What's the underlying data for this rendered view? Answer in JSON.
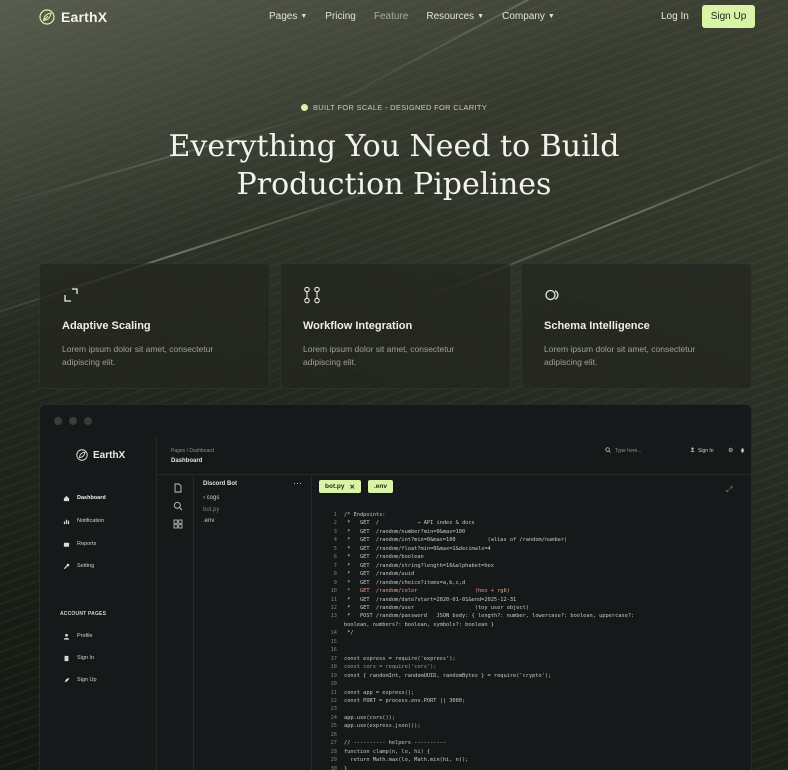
{
  "nav": {
    "logo": "EarthX",
    "menu": [
      {
        "label": "Pages",
        "has_dropdown": true
      },
      {
        "label": "Pricing",
        "has_dropdown": false
      },
      {
        "label": "Feature",
        "has_dropdown": false
      },
      {
        "label": "Resources",
        "has_dropdown": true
      },
      {
        "label": "Company",
        "has_dropdown": true
      }
    ],
    "login": "Log In",
    "signup": "Sign Up"
  },
  "hero": {
    "badge": "BUILT FOR SCALE - DESIGNED FOR CLARITY",
    "title_line1": "Everything You Need to Build",
    "title_line2": "Production Pipelines"
  },
  "features": [
    {
      "title": "Adaptive Scaling",
      "desc": "Lorem ipsum dolor sit amet, consectetur adipiscing elit.",
      "icon": "expand-icon"
    },
    {
      "title": "Workflow Integration",
      "desc": "Lorem ipsum dolor sit amet, consectetur adipiscing elit.",
      "icon": "branch-icon"
    },
    {
      "title": "Schema Intelligence",
      "desc": "Lorem ipsum dolor sit amet, consectetur adipiscing elit.",
      "icon": "circles-icon"
    }
  ],
  "app": {
    "logo": "EarthX",
    "sidebar": [
      {
        "label": "Dashboard",
        "icon": "home-icon"
      },
      {
        "label": "Notification",
        "icon": "chart-icon"
      },
      {
        "label": "Reports",
        "icon": "card-icon"
      },
      {
        "label": "Setting",
        "icon": "wrench-icon"
      }
    ],
    "section_label": "ACCOUNT PAGES",
    "account": [
      {
        "label": "Profile",
        "icon": "user-icon"
      },
      {
        "label": "Sign In",
        "icon": "doc-icon"
      },
      {
        "label": "Sign Up",
        "icon": "rocket-icon"
      }
    ],
    "breadcrumb": "Pages  /  Dashboard",
    "page_title": "Dashboard",
    "search_placeholder": "Type here...",
    "signin": "Sign In",
    "files_title": "Discord Bot",
    "files": [
      {
        "label": "cogs",
        "folder": true
      },
      {
        "label": "bot.py",
        "folder": false
      },
      {
        "label": ".env",
        "folder": false
      }
    ],
    "tabs": [
      {
        "label": "bot.py",
        "closable": true
      },
      {
        "label": ".env",
        "closable": false
      }
    ],
    "code_lines": [
      {
        "n": "1",
        "t": "/* Endpoints:",
        "s": ""
      },
      {
        "n": "2",
        "t": " *   GET  /            → API index & docs",
        "s": ""
      },
      {
        "n": "3",
        "t": " *   GET  /random/number?min=0&max=100",
        "s": ""
      },
      {
        "n": "4",
        "t": " *   GET  /random/int?min=0&max=100          (alias of /random/number)",
        "s": ""
      },
      {
        "n": "5",
        "t": " *   GET  /random/float?min=0&max=1&decimals=4",
        "s": ""
      },
      {
        "n": "6",
        "t": " *   GET  /random/boolean",
        "s": ""
      },
      {
        "n": "7",
        "t": " *   GET  /random/string?length=16&alphabet=hex",
        "s": ""
      },
      {
        "n": "8",
        "t": " *   GET  /random/uuid",
        "s": ""
      },
      {
        "n": "9",
        "t": " *   GET  /random/choice?items=a,b,c,d",
        "s": ""
      },
      {
        "n": "10",
        "t": " *   GET  /random/color                  (hex + rgb)",
        "s": "hl"
      },
      {
        "n": "11",
        "t": " *   GET  /random/date?start=2020-01-01&end=2025-12-31",
        "s": ""
      },
      {
        "n": "12",
        "t": " *   GET  /random/user                   (toy user object)",
        "s": ""
      },
      {
        "n": "13",
        "t": " *   POST /random/password   JSON body: { length?: number, lowercase?: boolean, uppercase?:",
        "s": ""
      },
      {
        "n": "",
        "t": "boolean, numbers?: boolean, symbols?: boolean }",
        "s": ""
      },
      {
        "n": "14",
        "t": " */",
        "s": ""
      },
      {
        "n": "15",
        "t": "",
        "s": ""
      },
      {
        "n": "16",
        "t": "",
        "s": ""
      },
      {
        "n": "17",
        "t": "const express = require('express');",
        "s": ""
      },
      {
        "n": "18",
        "t": "const cors = require('cors');",
        "s": "mut"
      },
      {
        "n": "19",
        "t": "const { randomInt, randomUUID, randomBytes } = require('crypto');",
        "s": ""
      },
      {
        "n": "20",
        "t": "",
        "s": ""
      },
      {
        "n": "21",
        "t": "const app = express();",
        "s": ""
      },
      {
        "n": "22",
        "t": "const PORT = process.env.PORT || 3000;",
        "s": ""
      },
      {
        "n": "23",
        "t": "",
        "s": ""
      },
      {
        "n": "24",
        "t": "app.use(cors());",
        "s": ""
      },
      {
        "n": "25",
        "t": "app.use(express.json());",
        "s": ""
      },
      {
        "n": "26",
        "t": "",
        "s": ""
      },
      {
        "n": "27",
        "t": "// ---------- helpers ----------",
        "s": ""
      },
      {
        "n": "28",
        "t": "function clamp(n, lo, hi) {",
        "s": ""
      },
      {
        "n": "29",
        "t": "  return Math.max(lo, Math.min(hi, n));",
        "s": ""
      },
      {
        "n": "30",
        "t": "}",
        "s": ""
      },
      {
        "n": "31",
        "t": "",
        "s": ""
      }
    ]
  },
  "colors": {
    "accent": "#d9f3a7",
    "background": "#23261f",
    "app_bg": "#16191a"
  }
}
